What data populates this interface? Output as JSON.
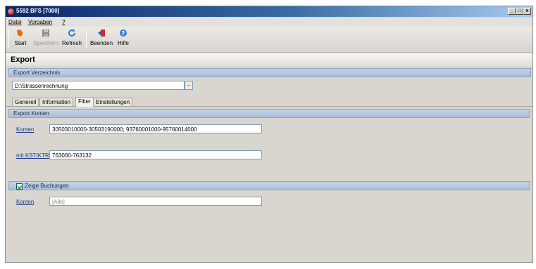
{
  "window": {
    "title": "5592 BFS [7000]",
    "controls": {
      "minimize": "_",
      "maximize": "□",
      "close": "x"
    }
  },
  "menu": [
    {
      "label": "Datei"
    },
    {
      "label": "Vorgaben"
    },
    {
      "label": "?"
    }
  ],
  "toolbar": {
    "buttons": [
      {
        "label": "Start",
        "icon": "start-icon",
        "enabled": true
      },
      {
        "label": "Speichern",
        "icon": "save-icon",
        "enabled": false
      },
      {
        "label": "Refresh",
        "icon": "refresh-icon",
        "enabled": true
      },
      {
        "label": "Beenden",
        "icon": "exit-icon",
        "enabled": true
      },
      {
        "label": "Hilfe",
        "icon": "help-icon",
        "enabled": true
      }
    ]
  },
  "page": {
    "title": "Export"
  },
  "export_dir": {
    "section_label": "Export Verzeichnis",
    "value": "D:\\Strassenrechnung",
    "browse_label": "..."
  },
  "tabs": [
    {
      "label": "Generell",
      "active": false
    },
    {
      "label": "Information",
      "active": false
    },
    {
      "label": "Filter",
      "active": true
    },
    {
      "label": "Einstellungen",
      "active": false
    }
  ],
  "export_konten": {
    "section_label": "Export Konten",
    "konten_link": "Konten",
    "konten_value": "30503010000-30503190000; 93760001000-95760014000",
    "kst_link": "mit KST/KTR",
    "kst_value": "763000-763132"
  },
  "buchungen": {
    "checkbox_label": "Zeige Buchungen",
    "checked": true,
    "konten_link": "Konten",
    "konten_value": "[Alle]"
  },
  "colors": {
    "titlebar": "#0a246a",
    "section": "#aabdd7",
    "window_bg": "#d9d6d0",
    "link": "#1a3c8c"
  }
}
